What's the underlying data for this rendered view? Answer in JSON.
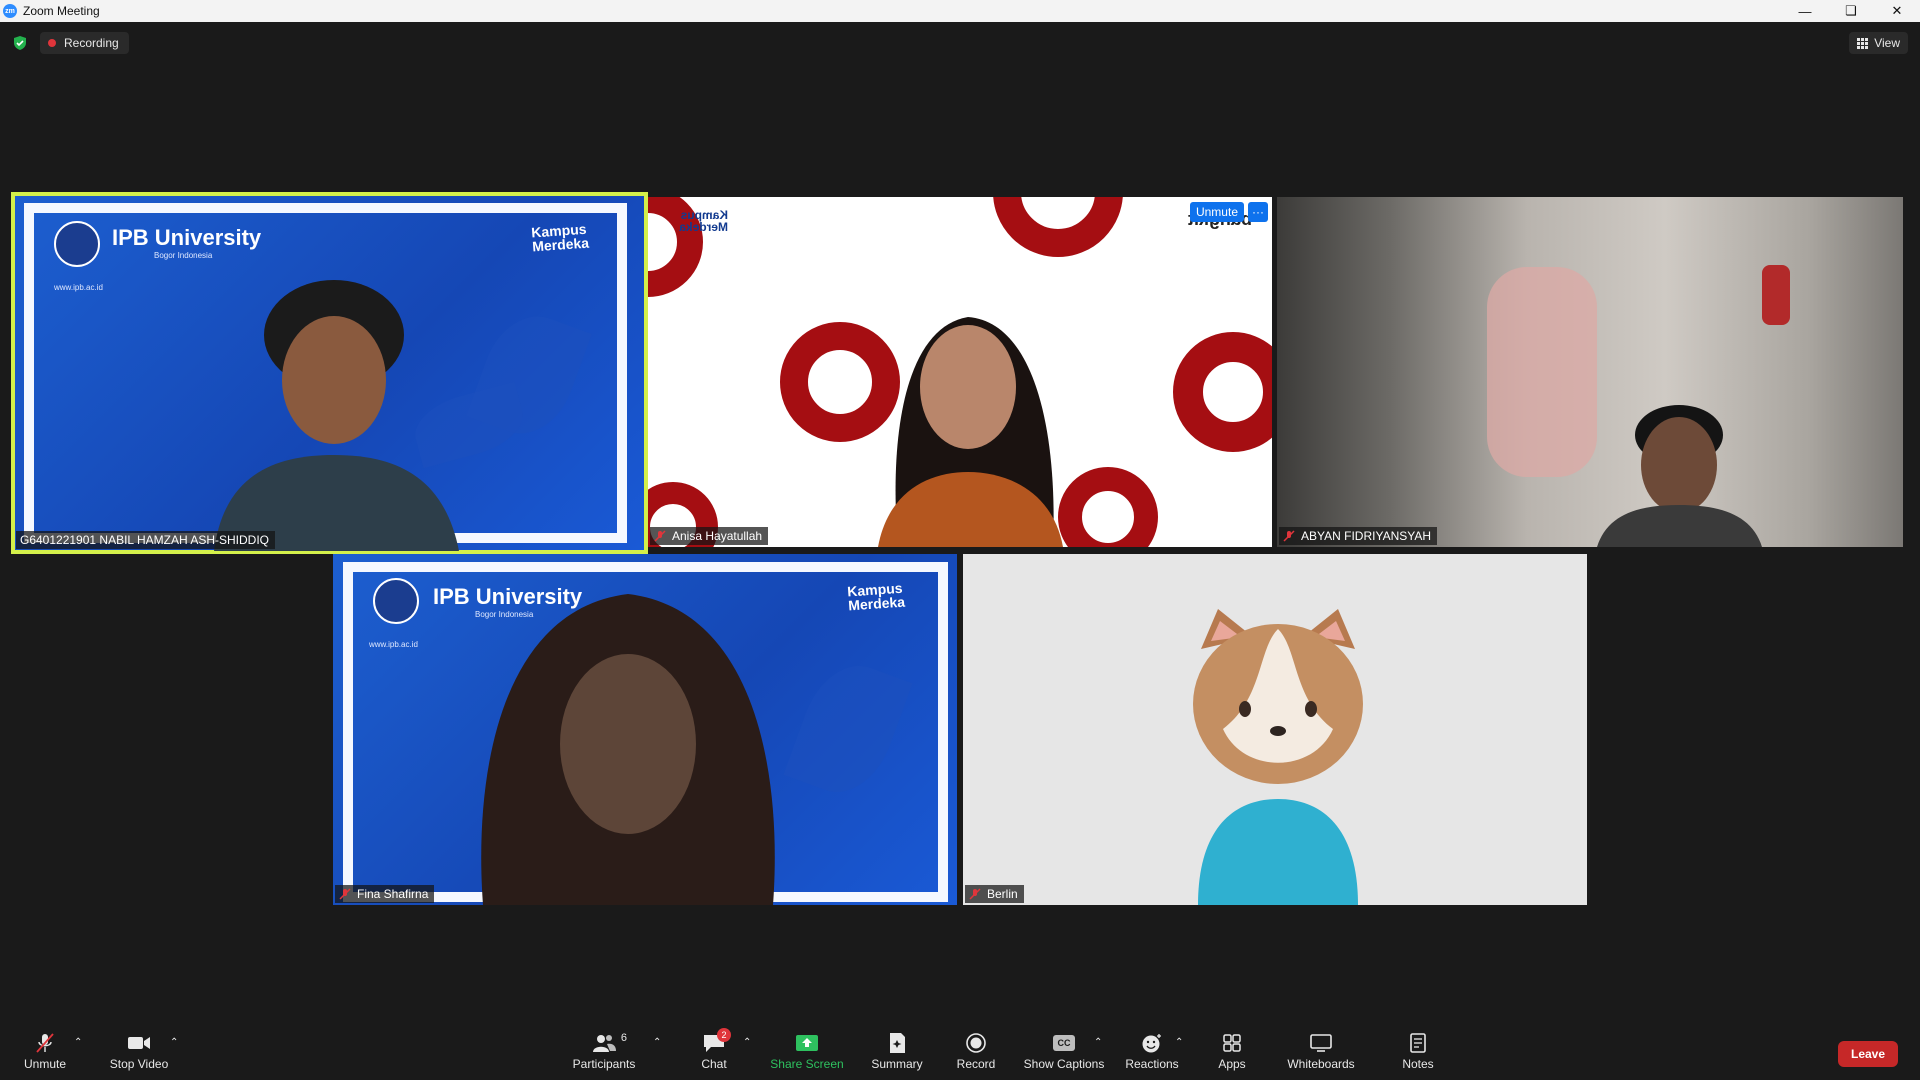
{
  "window": {
    "title": "Zoom Meeting",
    "app_logo": "zm"
  },
  "statusbar": {
    "recording_label": "Recording",
    "view_label": "View"
  },
  "tiles": [
    {
      "name": "G6401221901 NABIL HAMZAH ASH-SHIDDIQ",
      "muted": false,
      "background": "IPB University",
      "active": true
    },
    {
      "name": "Anisa Hayatullah",
      "muted": true,
      "background": "Kampus Merdeka",
      "overlay_unmute": "Unmute",
      "overlay_more": "···"
    },
    {
      "name": "ABYAN FIDRIYANSYAH",
      "muted": true,
      "background": "room"
    },
    {
      "name": "Fina Shafirna",
      "muted": true,
      "background": "IPB University"
    },
    {
      "name": "Berlin",
      "muted": true,
      "background": "avatar-cat"
    }
  ],
  "ipb": {
    "title": "IPB University",
    "subtitle": "Bogor Indonesia",
    "url": "www.ipb.ac.id",
    "kampus_line1": "Kampus",
    "kampus_line2": "Merdeka"
  },
  "tile2_logo": {
    "text": "bangkit"
  },
  "toolbar": {
    "unmute": "Unmute",
    "stop_video": "Stop Video",
    "participants": "Participants",
    "participants_count": "6",
    "chat": "Chat",
    "chat_badge": "2",
    "share_screen": "Share Screen",
    "summary": "Summary",
    "record": "Record",
    "show_captions": "Show Captions",
    "reactions": "Reactions",
    "apps": "Apps",
    "whiteboards": "Whiteboards",
    "notes": "Notes",
    "leave": "Leave"
  },
  "colors": {
    "accent": "#0e72ed",
    "active_speaker": "#d4f04a",
    "leave": "#c62828",
    "share": "#2ec15f",
    "mute_red": "#e0353b"
  }
}
